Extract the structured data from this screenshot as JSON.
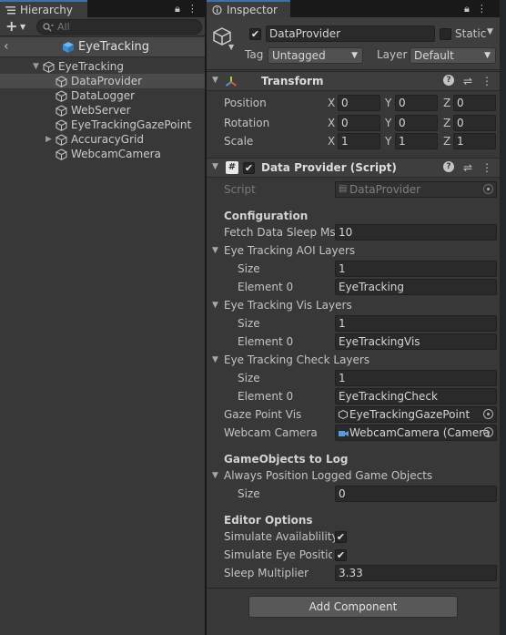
{
  "hierarchy": {
    "tab_label": "Hierarchy",
    "search_placeholder": "All",
    "scene_name": "EyeTracking",
    "items": [
      {
        "label": "EyeTracking"
      },
      {
        "label": "DataProvider"
      },
      {
        "label": "DataLogger"
      },
      {
        "label": "WebServer"
      },
      {
        "label": "EyeTrackingGazePoint"
      },
      {
        "label": "AccuracyGrid"
      },
      {
        "label": "WebcamCamera"
      }
    ]
  },
  "inspector": {
    "tab_label": "Inspector",
    "object_name": "DataProvider",
    "static_label": "Static",
    "tag_label": "Tag",
    "tag_value": "Untagged",
    "layer_label": "Layer",
    "layer_value": "Default",
    "transform": {
      "title": "Transform",
      "position_label": "Position",
      "rotation_label": "Rotation",
      "scale_label": "Scale",
      "axis_x": "X",
      "axis_y": "Y",
      "axis_z": "Z",
      "position": [
        "0",
        "0",
        "0"
      ],
      "rotation": [
        "0",
        "0",
        "0"
      ],
      "scale": [
        "1",
        "1",
        "1"
      ]
    },
    "script": {
      "title": "Data Provider (Script)",
      "script_label": "Script",
      "script_value": "DataProvider",
      "configuration_header": "Configuration",
      "fetch_label": "Fetch Data Sleep Ms",
      "fetch_value": "10",
      "aoi_label": "Eye Tracking AOI Layers",
      "vis_label": "Eye Tracking Vis Layers",
      "check_label": "Eye Tracking Check Layers",
      "size_label": "Size",
      "element0_label": "Element 0",
      "aoi_size": "1",
      "aoi_element0": "EyeTracking",
      "vis_size": "1",
      "vis_element0": "EyeTrackingVis",
      "check_size": "1",
      "check_element0": "EyeTrackingCheck",
      "gaze_label": "Gaze Point Vis",
      "gaze_value": "EyeTrackingGazePoint",
      "webcam_label": "Webcam Camera",
      "webcam_value": "WebcamCamera (Camera",
      "gameobjects_header": "GameObjects to Log",
      "always_label": "Always Position Logged Game Objects",
      "always_size": "0",
      "editor_header": "Editor Options",
      "simulate_avail_label": "Simulate Availablility",
      "simulate_pos_label": "Simulate Eye Position",
      "sleep_label": "Sleep Multiplier",
      "sleep_value": "3.33"
    },
    "add_component": "Add Component"
  },
  "colors": {
    "panel": "#383838",
    "field": "#2a2a2a",
    "selected": "#4b4b4b",
    "accent": "#3a72b0"
  }
}
